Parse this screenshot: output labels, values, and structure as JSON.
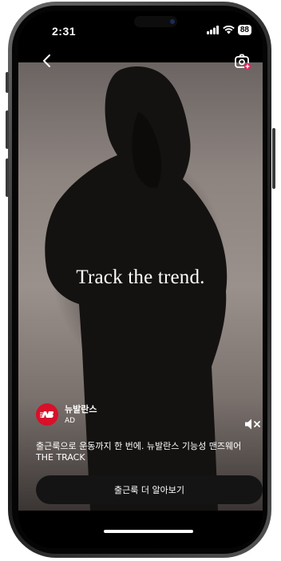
{
  "status_bar": {
    "time": "2:31",
    "battery": "88",
    "signal_icon": "signal-bars-icon",
    "wifi_icon": "wifi-icon"
  },
  "top_bar": {
    "back_icon": "chevron-left-icon",
    "camera_icon": "camera-icon"
  },
  "video": {
    "headline": "Track the trend."
  },
  "ad": {
    "brand_name": "뉴발란스",
    "ad_label": "AD",
    "caption": "출근룩으로 운동까지 한 번에. 뉴발란스 기능성 맨즈웨어 THE TRACK",
    "cta_label": "출근룩 더 알아보기",
    "mute_icon": "speaker-muted-icon",
    "brand_color": "#d8102a"
  }
}
